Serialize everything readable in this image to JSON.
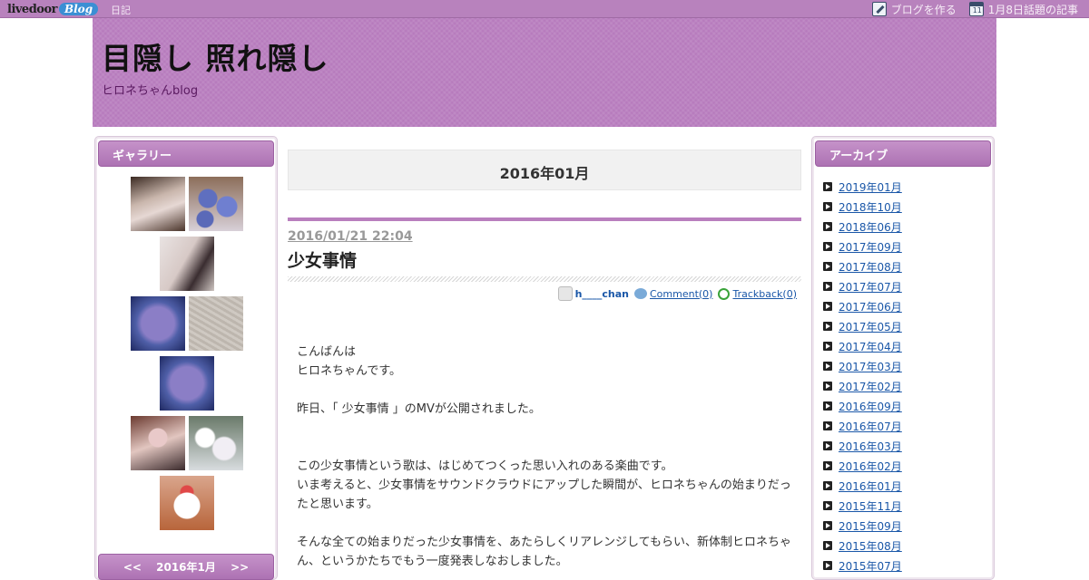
{
  "topbar": {
    "logo_main": "livedoor",
    "logo_blog": "Blog",
    "diary": "日記",
    "create_blog": "ブログを作る",
    "topic_articles": "1月8日話題の記事",
    "calendar_day": "11"
  },
  "header": {
    "title": "目隠し 照れ隠し",
    "subtitle": "ヒロネちゃんblog"
  },
  "gallery": {
    "heading": "ギャラリー",
    "calendar_nav": {
      "prev": "<<",
      "label": "2016年1月",
      "next": ">>"
    }
  },
  "archive": {
    "heading": "アーカイブ",
    "items": [
      "2019年01月",
      "2018年10月",
      "2018年06月",
      "2017年09月",
      "2017年08月",
      "2017年07月",
      "2017年06月",
      "2017年05月",
      "2017年04月",
      "2017年03月",
      "2017年02月",
      "2016年09月",
      "2016年07月",
      "2016年03月",
      "2016年02月",
      "2016年01月",
      "2015年11月",
      "2015年09月",
      "2015年08月",
      "2015年07月"
    ]
  },
  "main": {
    "month_heading": "2016年01月",
    "entry": {
      "date": "2016/01/21 22:04",
      "title": "少女事情",
      "author": "h____chan",
      "comment": "Comment(0)",
      "trackback": "Trackback(0)",
      "lines": [
        "こんばんは",
        "ヒロネちゃんです。",
        "",
        "昨日、「 少女事情 」のMVが公開されました。",
        "",
        "",
        "この少女事情という歌は、はじめてつくった思い入れのある楽曲です。",
        "いま考えると、少女事情をサウンドクラウドにアップした瞬間が、ヒロネちゃんの始まりだったと思います。",
        "",
        "そんな全ての始まりだった少女事情を、あたらしくリアレンジしてもらい、新体制ヒロネちゃん、というかたちでもう一度発表しなおしました。"
      ]
    }
  }
}
